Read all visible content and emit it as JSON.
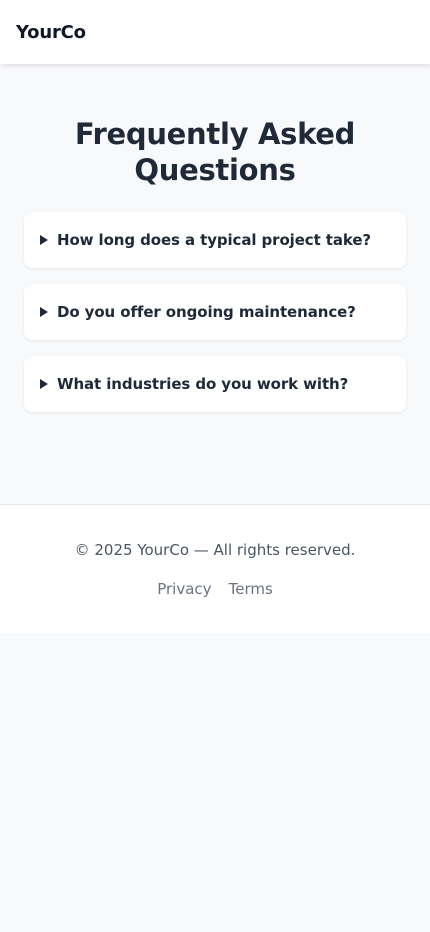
{
  "header": {
    "brand": "YourCo"
  },
  "main": {
    "title": "Frequently Asked Questions",
    "faqs": [
      {
        "question": "How long does a typical project take?"
      },
      {
        "question": "Do you offer ongoing maintenance?"
      },
      {
        "question": "What industries do you work with?"
      }
    ]
  },
  "footer": {
    "copyright": "© 2025 YourCo — All rights reserved.",
    "links": [
      "Privacy",
      "Terms"
    ]
  },
  "icons": {
    "faq_toggle": "triangle-right-icon"
  }
}
